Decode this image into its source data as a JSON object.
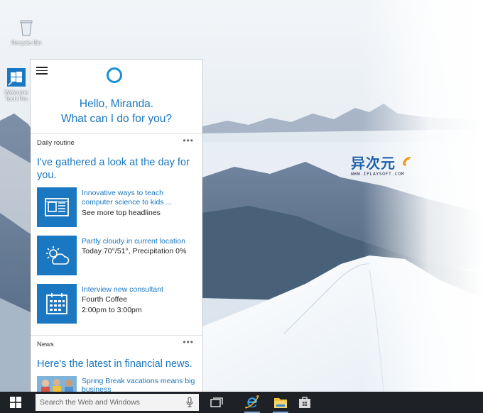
{
  "desktop": {
    "icons": [
      {
        "name": "recycle-bin",
        "label": "Recycle Bin"
      },
      {
        "name": "welcome-tech-preview",
        "label": "Welcome Tech Pre"
      }
    ],
    "watermark": {
      "cn": "异次元",
      "en": "WWW.IPLAYSOFT.COM"
    }
  },
  "cortana": {
    "greeting_line1": "Hello, Miranda.",
    "greeting_line2": "What can I do for you?",
    "daily": {
      "label": "Daily routine",
      "more": "•••",
      "title": "I've gathered a look at the day for you.",
      "cards": [
        {
          "icon": "news-icon",
          "title": "Innovative ways to teach computer science to kids ...",
          "sub1": "See more top headlines",
          "sub2": ""
        },
        {
          "icon": "weather-partly-cloudy-icon",
          "title": "Partly cloudy in current location",
          "sub1": "Today 70°/51°, Precipitation 0%",
          "sub2": ""
        },
        {
          "icon": "calendar-icon",
          "title": "Interview new consultant",
          "sub1": "Fourth Coffee",
          "sub2": "2:00pm to 3:00pm"
        }
      ]
    },
    "news": {
      "label": "News",
      "more": "•••",
      "title": "Here's the latest in financial news.",
      "item": {
        "title": "Spring Break vacations means big business"
      }
    }
  },
  "taskbar": {
    "search_placeholder": "Search the Web and Windows",
    "buttons": [
      "task-view",
      "internet-explorer",
      "file-explorer",
      "windows-store"
    ]
  },
  "colors": {
    "accent": "#1a76c0",
    "tile": "#1a78c2",
    "taskbar": "#1e2227"
  }
}
